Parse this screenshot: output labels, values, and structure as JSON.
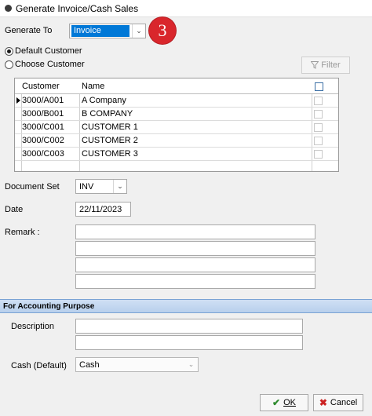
{
  "window": {
    "title": "Generate Invoice/Cash Sales"
  },
  "generate_to": {
    "label": "Generate To",
    "value": "Invoice"
  },
  "step_badge": "3",
  "options": {
    "default_customer": "Default Customer",
    "choose_customer": "Choose Customer"
  },
  "filter_button": "Filter",
  "grid": {
    "headers": [
      "Customer",
      "Name"
    ],
    "rows": [
      {
        "code": "3000/A001",
        "name": "A Company"
      },
      {
        "code": "3000/B001",
        "name": "B COMPANY"
      },
      {
        "code": "3000/C001",
        "name": "CUSTOMER 1"
      },
      {
        "code": "3000/C002",
        "name": "CUSTOMER 2"
      },
      {
        "code": "3000/C003",
        "name": "CUSTOMER 3"
      }
    ]
  },
  "document_set": {
    "label": "Document Set",
    "value": "INV"
  },
  "date": {
    "label": "Date",
    "value": "22/11/2023"
  },
  "remark": {
    "label": "Remark :"
  },
  "accounting": {
    "title": "For Accounting Purpose",
    "description_label": "Description",
    "cash_label": "Cash (Default)",
    "cash_value": "Cash"
  },
  "buttons": {
    "ok": "OK",
    "cancel": "Cancel"
  },
  "colors": {
    "selection": "#0078d7",
    "badge": "#d9262c",
    "section_bar": "#b8d0ec"
  }
}
